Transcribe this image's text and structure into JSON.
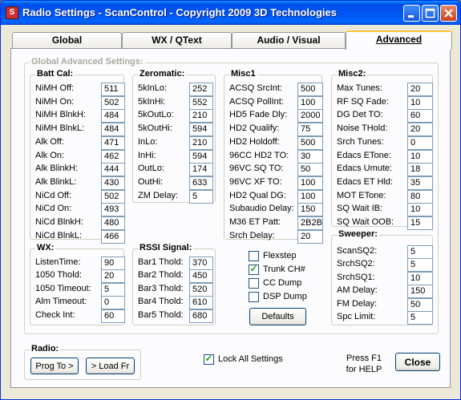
{
  "window": {
    "title": "Radio Settings - ScanControl - Copyright 2009 3D Technologies"
  },
  "tabs": [
    "Global",
    "WX / QText",
    "Audio / Visual",
    "Advanced"
  ],
  "advanced": {
    "title": "Global Advanced Settings:"
  },
  "batt_cal": {
    "title": "Batt Cal:",
    "rows": [
      {
        "label": "NiMH Off:",
        "value": "511"
      },
      {
        "label": "NiMH On:",
        "value": "502"
      },
      {
        "label": "NiMH BlnkH:",
        "value": "484"
      },
      {
        "label": "NiMH BlnkL:",
        "value": "484"
      },
      {
        "label": "Alk Off:",
        "value": "471"
      },
      {
        "label": "Alk On:",
        "value": "462"
      },
      {
        "label": "Alk BlinkH:",
        "value": "444"
      },
      {
        "label": "Alk BlinkL:",
        "value": "430"
      },
      {
        "label": "NiCd Off:",
        "value": "502"
      },
      {
        "label": "NiCd On:",
        "value": "493"
      },
      {
        "label": "NiCd BlnkH:",
        "value": "480"
      },
      {
        "label": "NiCd BlnkL:",
        "value": "466"
      }
    ]
  },
  "zeromatic": {
    "title": "Zeromatic:",
    "rows": [
      {
        "label": "5kInLo:",
        "value": "252"
      },
      {
        "label": "5kInHi:",
        "value": "552"
      },
      {
        "label": "5kOutLo:",
        "value": "210"
      },
      {
        "label": "5kOutHi:",
        "value": "594"
      },
      {
        "label": "InLo:",
        "value": "210"
      },
      {
        "label": "InHi:",
        "value": "594"
      },
      {
        "label": "OutLo:",
        "value": "174"
      },
      {
        "label": "OutHi:",
        "value": "633"
      },
      {
        "label": "ZM Delay:",
        "value": "5"
      }
    ]
  },
  "misc1": {
    "title": "Misc1",
    "rows": [
      {
        "label": "ACSQ SrcInt:",
        "value": "500"
      },
      {
        "label": "ACSQ PollInt:",
        "value": "100"
      },
      {
        "label": "HD5 Fade Dly:",
        "value": "2000"
      },
      {
        "label": "HD2 Qualify:",
        "value": "75"
      },
      {
        "label": "HD2 Holdoff:",
        "value": "500"
      },
      {
        "label": "96CC HD2 TO:",
        "value": "30"
      },
      {
        "label": "96VC SQ TO:",
        "value": "50"
      },
      {
        "label": "96VC XF TO:",
        "value": "100"
      },
      {
        "label": "HD2 Qual DG:",
        "value": "100"
      },
      {
        "label": "Subaudio Delay:",
        "value": "150"
      },
      {
        "label": "M36 ET Patt:",
        "value": "2B2B"
      },
      {
        "label": "Srch Delay:",
        "value": "20"
      }
    ]
  },
  "misc2": {
    "title": "Misc2:",
    "rows": [
      {
        "label": "Max Tunes:",
        "value": "20"
      },
      {
        "label": "RF SQ Fade:",
        "value": "10"
      },
      {
        "label": "DG Det TO:",
        "value": "60"
      },
      {
        "label": "Noise THold:",
        "value": "20"
      },
      {
        "label": "Srch Tunes:",
        "value": "0"
      },
      {
        "label": "Edacs ETone:",
        "value": "10"
      },
      {
        "label": "Edacs Umute:",
        "value": "18"
      },
      {
        "label": "Edacs ET Hld:",
        "value": "35"
      },
      {
        "label": "MOT ETone:",
        "value": "80"
      },
      {
        "label": "SQ Wait IB:",
        "value": "10"
      },
      {
        "label": "SQ Wait OOB:",
        "value": "15"
      }
    ]
  },
  "wx": {
    "title": "WX:",
    "rows": [
      {
        "label": "ListenTime:",
        "value": "90"
      },
      {
        "label": "1050 Thold:",
        "value": "20"
      },
      {
        "label": "1050 Timeout:",
        "value": "5"
      },
      {
        "label": "Alm Timeout:",
        "value": "0"
      },
      {
        "label": "Check Int:",
        "value": "60"
      }
    ]
  },
  "rssi": {
    "title": "RSSI Signal:",
    "rows": [
      {
        "label": "Bar1 Thold:",
        "value": "370"
      },
      {
        "label": "Bar2 Thold:",
        "value": "450"
      },
      {
        "label": "Bar3 Thold:",
        "value": "520"
      },
      {
        "label": "Bar4 Thold:",
        "value": "610"
      },
      {
        "label": "Bar5 Thold:",
        "value": "680"
      }
    ]
  },
  "checks": [
    {
      "label": "Flexstep",
      "checked": false
    },
    {
      "label": "Trunk CH#",
      "checked": true
    },
    {
      "label": "CC Dump",
      "checked": false
    },
    {
      "label": "DSP Dump",
      "checked": false
    }
  ],
  "defaults_label": "Defaults",
  "sweeper": {
    "title": "Sweeper:",
    "rows": [
      {
        "label": "ScanSQ2:",
        "value": "5"
      },
      {
        "label": "SrchSQ2:",
        "value": "5"
      },
      {
        "label": "SrchSQ1:",
        "value": "10"
      },
      {
        "label": "AM Delay:",
        "value": "150"
      },
      {
        "label": "FM Delay:",
        "value": "50"
      },
      {
        "label": "Spc Limit:",
        "value": "5"
      }
    ]
  },
  "radio": {
    "title": "Radio:",
    "prog_label": "Prog To >",
    "load_label": "> Load Fr"
  },
  "lock": {
    "label": "Lock All Settings",
    "checked": true
  },
  "help": {
    "line1": "Press F1",
    "line2": "for HELP"
  },
  "close_label": "Close"
}
